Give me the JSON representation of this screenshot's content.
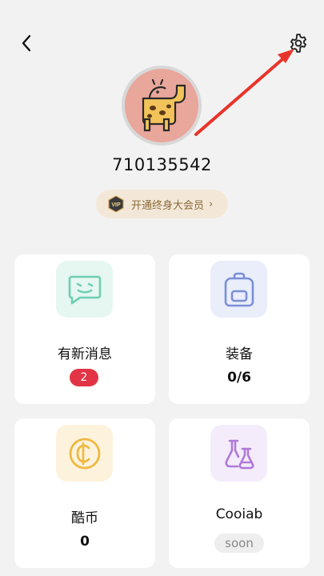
{
  "header": {
    "back_icon": "chevron-left-icon",
    "settings_icon": "gear-icon"
  },
  "profile": {
    "avatar_icon": "giraffe-icon",
    "user_id": "710135542",
    "vip_badge": "VIP",
    "vip_label": "开通终身大会员",
    "vip_chevron": "›"
  },
  "cards": {
    "messages": {
      "title": "有新消息",
      "badge": "2",
      "icon": "chat-bubble-icon",
      "accent": "#6fcfb2"
    },
    "equipment": {
      "title": "装备",
      "value": "0/6",
      "icon": "backpack-icon",
      "accent": "#7a8fd8"
    },
    "coins": {
      "title": "酷币",
      "value": "0",
      "icon": "coin-icon",
      "accent": "#f0b840"
    },
    "lab": {
      "title": "Cooiab",
      "status": "soon",
      "icon": "lab-flask-icon",
      "accent": "#b07ad8"
    }
  },
  "annotation": {
    "color": "#e8342a"
  }
}
